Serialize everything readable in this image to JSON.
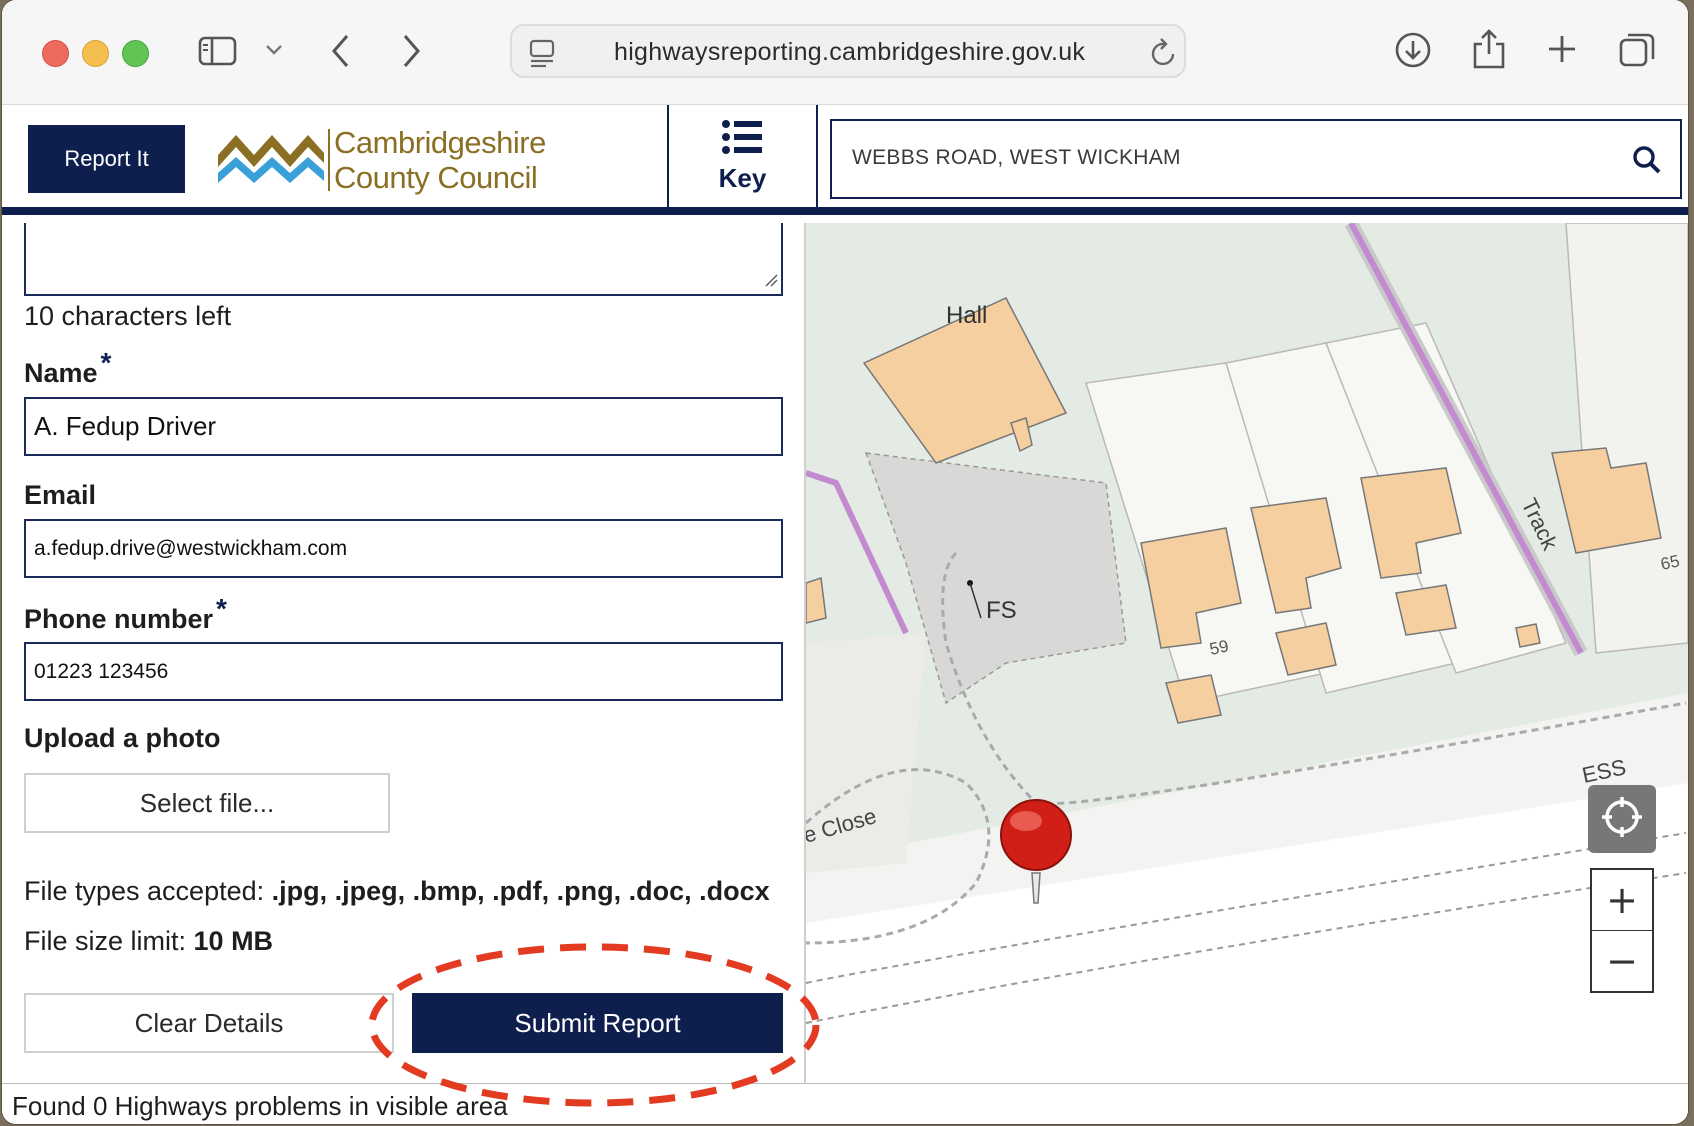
{
  "browser": {
    "url": "highwaysreporting.cambridgeshire.gov.uk",
    "icons": [
      "sidebar-icon",
      "chevron-down-icon",
      "back-icon",
      "forward-icon",
      "reader-icon",
      "reload-icon",
      "download-icon",
      "share-icon",
      "new-tab-icon",
      "tabs-icon"
    ]
  },
  "header": {
    "report_label": "Report It",
    "logo_line1": "Cambridgeshire",
    "logo_line2": "County Council",
    "key_label": "Key",
    "search_value": "WEBBS ROAD, WEST WICKHAM"
  },
  "form": {
    "chars_left": "10 characters left",
    "name_label": "Name",
    "name_value": "A. Fedup Driver",
    "email_label": "Email",
    "email_value": "a.fedup.drive@westwickham.com",
    "phone_label": "Phone number",
    "phone_value": "01223 123456",
    "required_mark": "*",
    "upload_label": "Upload a photo",
    "select_file_label": "Select file...",
    "file_types_label": "File types accepted:",
    "file_types_value": ".jpg, .jpeg, .bmp, .pdf, .png, .doc, .docx",
    "file_size_label": "File size limit:",
    "file_size_value": "10 MB",
    "clear_label": "Clear Details",
    "submit_label": "Submit Report"
  },
  "map": {
    "labels": {
      "hall": "Hall",
      "fs": "FS",
      "track": "Track",
      "close": "e Close",
      "ess": "ESS",
      "house59": "59",
      "house65": "65"
    },
    "zoom_in": "+",
    "zoom_out": "−"
  },
  "status": {
    "text": "Found 0 Highways problems in visible area"
  },
  "colors": {
    "brand_navy": "#0e1f4d",
    "logo_gold": "#8a6f24",
    "logo_blue": "#3aa0d8",
    "annotation_red": "#e23b22",
    "building": "#f5cfa0",
    "path_purple": "#c48ad0"
  }
}
